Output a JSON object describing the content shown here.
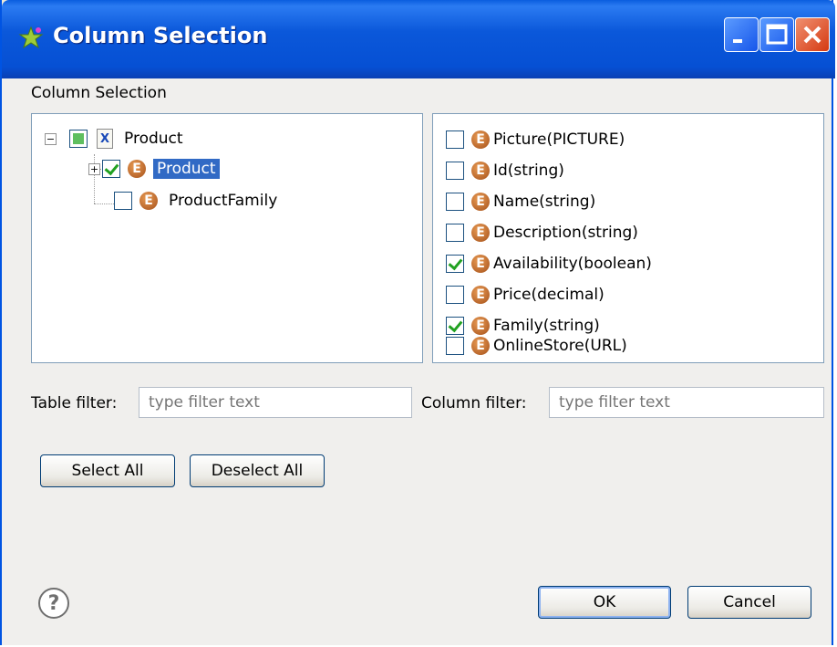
{
  "window": {
    "title": "Column Selection"
  },
  "section_label": "Column Selection",
  "tree": {
    "root": {
      "label": "Product",
      "expander": "−"
    },
    "children": [
      {
        "label": "Product",
        "checked": true,
        "selected": true,
        "expander": "+"
      },
      {
        "label": "ProductFamily",
        "checked": false,
        "selected": false
      }
    ]
  },
  "columns": [
    {
      "label": "Picture(PICTURE)",
      "checked": false
    },
    {
      "label": "Id(string)",
      "checked": false
    },
    {
      "label": "Name(string)",
      "checked": false
    },
    {
      "label": "Description(string)",
      "checked": false
    },
    {
      "label": "Availability(boolean)",
      "checked": true
    },
    {
      "label": "Price(decimal)",
      "checked": false
    },
    {
      "label": "Family(string)",
      "checked": true
    },
    {
      "label": "OnlineStore(URL)",
      "checked": false
    }
  ],
  "filters": {
    "table_label": "Table filter:",
    "table_placeholder": "type filter text",
    "column_label": "Column filter:",
    "column_placeholder": "type filter text"
  },
  "buttons": {
    "select_all": "Select All",
    "deselect_all": "Deselect All",
    "ok": "OK",
    "cancel": "Cancel",
    "help": "?"
  },
  "icons": {
    "entity_glyph": "E",
    "xsd_glyph": "X"
  },
  "colors": {
    "title_bar": "#0a5ddf",
    "selection": "#316ac5",
    "check": "#21a121",
    "entity_icon": "#c46a2a"
  }
}
